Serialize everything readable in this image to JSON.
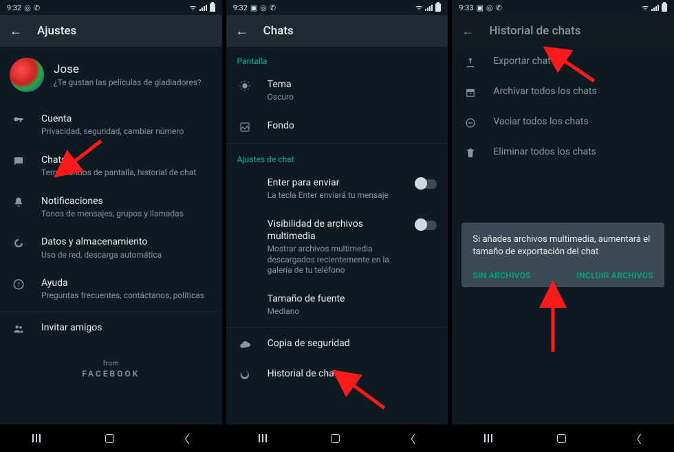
{
  "status": {
    "time_a": "9:32",
    "time_b": "9:32",
    "time_c": "9:33"
  },
  "panel1": {
    "title": "Ajustes",
    "profile": {
      "name": "Jose",
      "status": "¿Te gustan las películas de gladiadores?"
    },
    "items": [
      {
        "title": "Cuenta",
        "sub": "Privacidad, seguridad, cambiar número"
      },
      {
        "title": "Chats",
        "sub": "Tema, fondos de pantalla, historial de chat"
      },
      {
        "title": "Notificaciones",
        "sub": "Tonos de mensajes, grupos y llamadas"
      },
      {
        "title": "Datos y almacenamiento",
        "sub": "Uso de red, descarga automática"
      },
      {
        "title": "Ayuda",
        "sub": "Preguntas frecuentes, contáctanos, políticas"
      },
      {
        "title": "Invitar amigos",
        "sub": ""
      }
    ],
    "footer": {
      "from": "from",
      "brand": "FACEBOOK"
    }
  },
  "panel2": {
    "title": "Chats",
    "section_display": "Pantalla",
    "display_items": [
      {
        "title": "Tema",
        "sub": "Oscuro"
      },
      {
        "title": "Fondo",
        "sub": ""
      }
    ],
    "section_settings": "Ajustes de chat",
    "settings_items": [
      {
        "title": "Enter para enviar",
        "sub": "La tecla Enter enviará tu mensaje",
        "switch": true
      },
      {
        "title": "Visibilidad de archivos multimedia",
        "sub": "Mostrar archivos multimedia descargados recientemente en la galería de tu teléfono",
        "switch": true
      },
      {
        "title": "Tamaño de fuente",
        "sub": "Mediano",
        "switch": false
      }
    ],
    "bottom_items": [
      {
        "title": "Copia de seguridad"
      },
      {
        "title": "Historial de chats"
      }
    ]
  },
  "panel3": {
    "title": "Historial de chats",
    "items": [
      {
        "title": "Exportar chat"
      },
      {
        "title": "Archivar todos los chats"
      },
      {
        "title": "Vaciar todos los chats"
      },
      {
        "title": "Eliminar todos los chats"
      }
    ],
    "dialog": {
      "message": "Si añades archivos multimedia, aumentará el tamaño de exportación del chat",
      "no_files": "SIN ARCHIVOS",
      "include": "INCLUIR ARCHIVOS"
    }
  }
}
